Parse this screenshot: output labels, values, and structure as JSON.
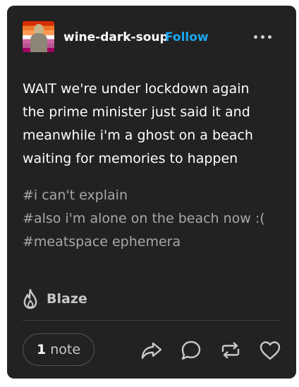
{
  "post": {
    "blog_name": "wine-dark-soup",
    "follow_label": "Follow",
    "body_lines": [
      "WAIT we're under lockdown again",
      "the prime minister just said it and",
      "meanwhile i'm a ghost on a beach",
      "waiting for memories to happen"
    ],
    "tags": [
      "#i can't explain",
      "#also i'm alone on the beach now :(",
      "#meatspace ephemera"
    ]
  },
  "footer": {
    "blaze_label": "Blaze",
    "notes_count": "1",
    "notes_label": "note"
  },
  "icons": {
    "avatar": "avatar-icon",
    "more": "more-options-icon",
    "blaze": "flame-icon",
    "share": "share-icon",
    "reply": "reply-icon",
    "reblog": "reblog-icon",
    "like": "heart-icon"
  },
  "colors": {
    "card_background": "#222222",
    "follow_accent": "#1ba8f0",
    "tag_text": "#a8a8a8"
  }
}
